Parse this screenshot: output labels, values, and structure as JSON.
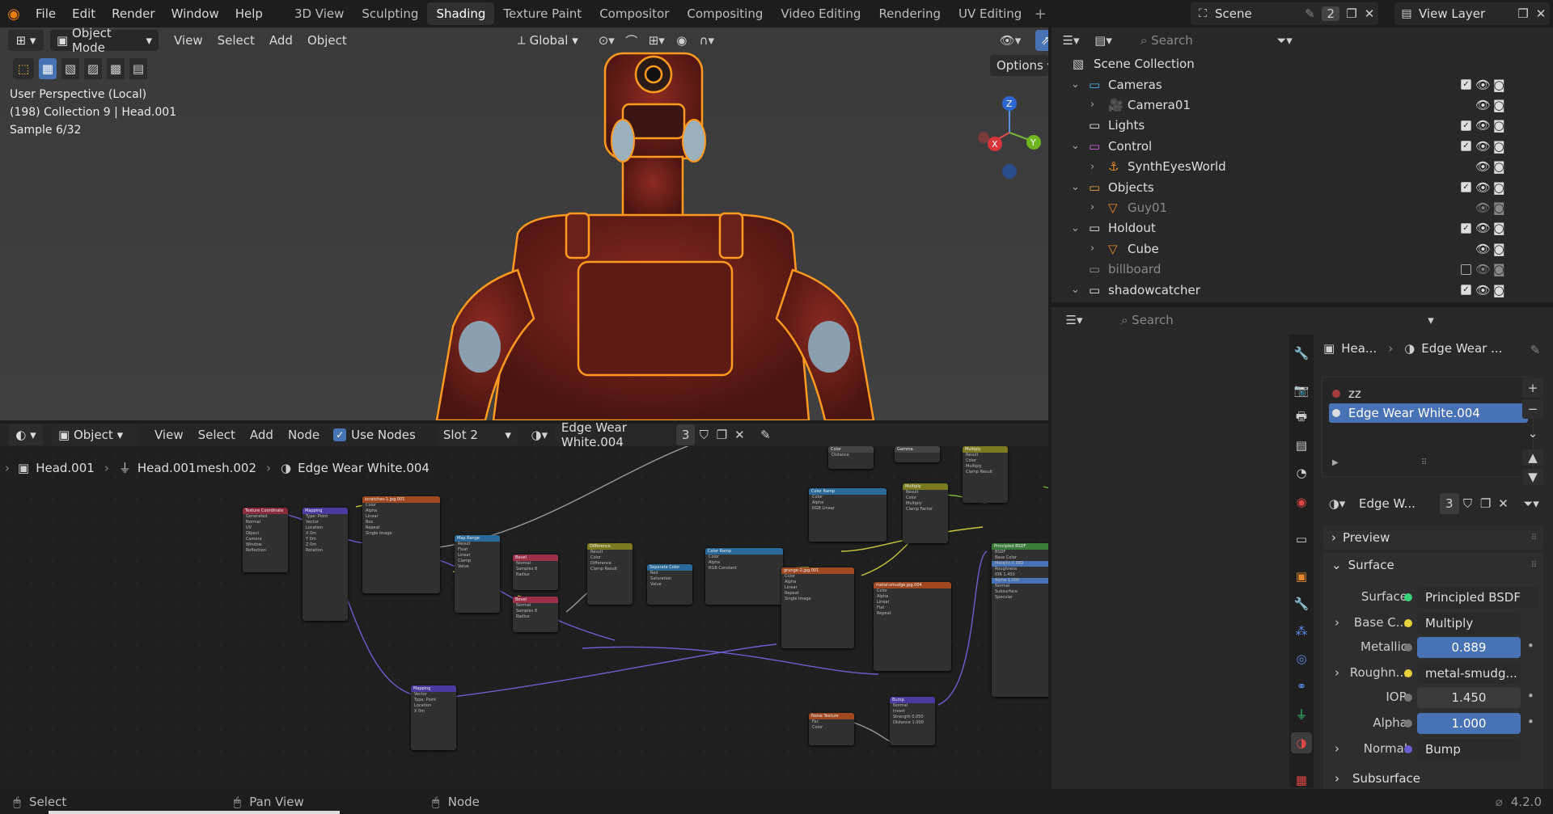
{
  "topbar": {
    "menus": [
      "File",
      "Edit",
      "Render",
      "Window",
      "Help"
    ],
    "workspaces": [
      "3D View",
      "Sculpting",
      "Shading",
      "Texture Paint",
      "Compositor",
      "Compositing",
      "Video Editing",
      "Rendering",
      "UV Editing"
    ],
    "active_workspace": "Shading",
    "scene_label": "Scene",
    "scene_users": "2",
    "view_layer_label": "View Layer"
  },
  "viewport": {
    "mode": "Object Mode",
    "menus": [
      "View",
      "Select",
      "Add",
      "Object"
    ],
    "orientation": "Global",
    "options_label": "Options",
    "info_line1": "User Perspective (Local)",
    "info_line2": "(198) Collection 9 | Head.001",
    "info_line3": "Sample 6/32",
    "gizmo_x": "X",
    "gizmo_y": "Y",
    "gizmo_z": "Z"
  },
  "node_editor": {
    "mode": "Object",
    "menus": [
      "View",
      "Select",
      "Add",
      "Node"
    ],
    "use_nodes_label": "Use Nodes",
    "slot": "Slot 2",
    "material": "Edge Wear White.004",
    "users": "3",
    "breadcrumb": [
      "Head.001",
      "Head.001mesh.002",
      "Edge Wear White.004"
    ]
  },
  "outliner": {
    "search_placeholder": "Search",
    "root": "Scene Collection",
    "rows": [
      {
        "label": "Cameras",
        "indent": 0,
        "type": "collection"
      },
      {
        "label": "Camera01",
        "indent": 1,
        "type": "camera"
      },
      {
        "label": "Lights",
        "indent": 0,
        "type": "collection"
      },
      {
        "label": "Control",
        "indent": 0,
        "type": "collection"
      },
      {
        "label": "SynthEyesWorld",
        "indent": 1,
        "type": "empty"
      },
      {
        "label": "Objects",
        "indent": 0,
        "type": "collection"
      },
      {
        "label": "Guy01",
        "indent": 1,
        "type": "mesh"
      },
      {
        "label": "Holdout",
        "indent": 0,
        "type": "collection"
      },
      {
        "label": "Cube",
        "indent": 1,
        "type": "mesh"
      },
      {
        "label": "billboard",
        "indent": 0,
        "type": "collection"
      },
      {
        "label": "shadowcatcher",
        "indent": 0,
        "type": "collection"
      }
    ]
  },
  "properties": {
    "search_placeholder": "Search",
    "breadcrumb_object": "Hea...",
    "breadcrumb_material": "Edge Wear ...",
    "slots": [
      "zz",
      "Edge Wear White.004"
    ],
    "material_short": "Edge W...",
    "users": "3",
    "sections": {
      "preview": "Preview",
      "surface": "Surface",
      "subsurface": "Subsurface"
    },
    "rows": [
      {
        "label": "Surface",
        "value": "Principled BSDF",
        "kind": "shader"
      },
      {
        "label": "Base C...",
        "value": "Multiply",
        "kind": "link",
        "expand": true
      },
      {
        "label": "Metallic",
        "value": "0.889",
        "kind": "num"
      },
      {
        "label": "Roughn...",
        "value": "metal-smudg...",
        "kind": "link",
        "expand": true
      },
      {
        "label": "IOR",
        "value": "1.450",
        "kind": "plain"
      },
      {
        "label": "Alpha",
        "value": "1.000",
        "kind": "num"
      },
      {
        "label": "Normal",
        "value": "Bump",
        "kind": "vector",
        "expand": true
      }
    ]
  },
  "statusbar": {
    "select": "Select",
    "pan": "Pan View",
    "node": "Node",
    "version": "4.2.0"
  },
  "colors": {
    "accent": "#4772b3",
    "selection": "#ff9a1f",
    "robot": "#7a1f1a"
  }
}
